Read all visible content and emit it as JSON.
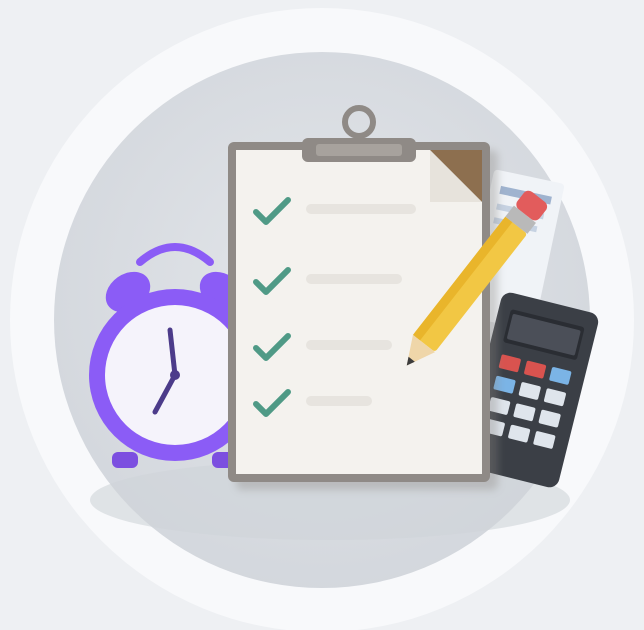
{
  "illustration": {
    "subject": "clipboard-checklist-with-clock-pencil-calculator",
    "checklist": {
      "items": [
        {
          "checked": true
        },
        {
          "checked": true
        },
        {
          "checked": true
        },
        {
          "checked": true
        }
      ]
    },
    "icons": [
      "clipboard-icon",
      "alarm-clock-icon",
      "pencil-icon",
      "calculator-icon",
      "checkmark-icon"
    ]
  },
  "colors": {
    "page_background": "#eef0f3",
    "outer_ring": "#f7f8fa",
    "inner_disc": "#d9dde2",
    "paper": "#f4f2ee",
    "clipboard_frame": "#8f8a86",
    "checkmark": "#4f9a86",
    "clock": "#8b5cf6",
    "pencil": "#f2c744",
    "calculator": "#3d4148"
  }
}
